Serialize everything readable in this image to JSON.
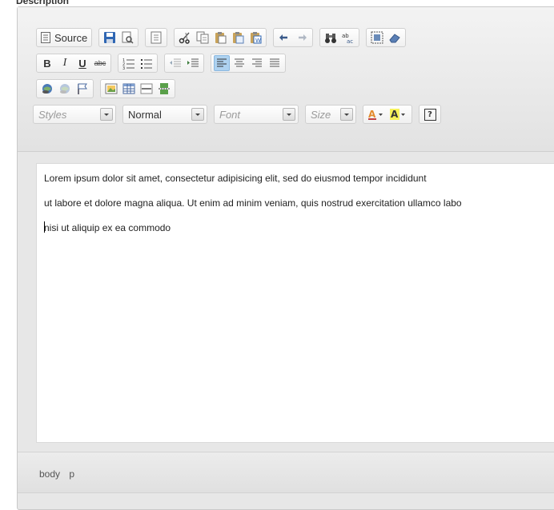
{
  "field_label": "Description",
  "toolbar": {
    "source_label": "Source",
    "styles_placeholder": "Styles",
    "format_value": "Normal",
    "font_placeholder": "Font",
    "size_placeholder": "Size",
    "bold_glyph": "B",
    "italic_glyph": "I",
    "underline_glyph": "U",
    "strike_glyph": "abc",
    "about_glyph": "?"
  },
  "content": {
    "lines": [
      "Lorem ipsum dolor sit amet, consectetur adipisicing elit, sed do eiusmod tempor incididunt",
      "ut labore et dolore magna aliqua. Ut enim ad minim veniam, quis nostrud exercitation ullamco labo",
      "nisi ut aliquip ex ea commodo"
    ]
  },
  "elements_path": [
    "body",
    "p"
  ],
  "colors": {
    "active_button": "#aed2f0",
    "toolbar_bg": "#e7e7e7",
    "content_bg": "#ffffff"
  }
}
